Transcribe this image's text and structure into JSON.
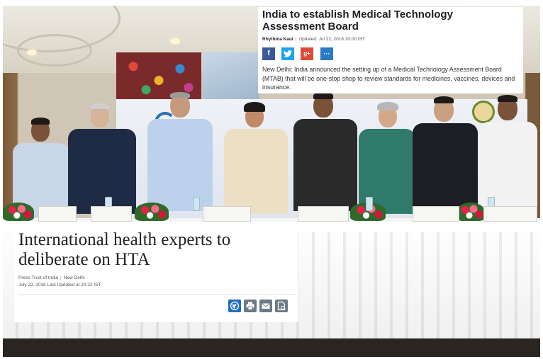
{
  "article_top": {
    "headline": "India to establish Medical Technology Assessment Board",
    "author": "Rhythma Kaul",
    "updated": "Updated: Jul 22, 2016 20:00 IST",
    "share_buttons": [
      {
        "label": "f",
        "icon": "facebook-icon"
      },
      {
        "label": "t",
        "icon": "twitter-icon"
      },
      {
        "label": "g+",
        "icon": "google-plus-icon"
      },
      {
        "label": "···",
        "icon": "more-icon"
      }
    ],
    "summary": "New Delhi: India announced the setting up of a Medical Technology Assessment Board (MTAB) that will be one-stop shop to review standards for medicines, vaccines, devices and insurance."
  },
  "article_bottom": {
    "headline": "International health experts to deliberate on HTA",
    "source": "Press Trust of India",
    "location": "New Delhi",
    "updated": "July 22, 2016 Last Updated at 20:22 IST",
    "tools": [
      {
        "icon": "globe-icon"
      },
      {
        "icon": "print-icon"
      },
      {
        "icon": "mail-icon"
      },
      {
        "icon": "save-icon"
      }
    ]
  },
  "colors": {
    "facebook": "#3b5998",
    "twitter": "#1da1f2",
    "google_plus": "#dd4b39",
    "more": "#2a7ac4",
    "tool_globe": "#1f6fc0",
    "tool_gray": "#6d7a86"
  }
}
